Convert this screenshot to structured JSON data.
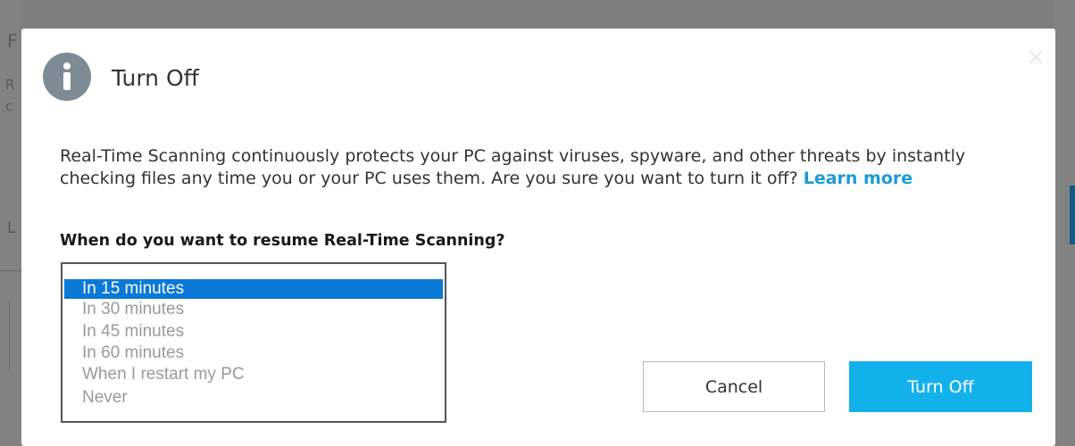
{
  "dialog": {
    "title": "Turn Off",
    "description": "Real-Time Scanning continuously protects your PC against viruses, spyware, and other threats by instantly checking files any time you or your PC uses them. Are you sure you want to turn it off?",
    "learn_more_label": "Learn more",
    "question": "When do you want to resume Real-Time Scanning?",
    "resume_options": [
      "In 15 minutes",
      "In 30 minutes",
      "In 45 minutes",
      "In 60 minutes",
      "When I restart my PC",
      "Never"
    ],
    "selected_option": "In 15 minutes",
    "cancel_label": "Cancel",
    "confirm_label": "Turn Off"
  },
  "background": {
    "glyphs": [
      "F",
      "R",
      "c",
      "L"
    ]
  },
  "icons": {
    "header": "info-icon",
    "close": "close-icon"
  },
  "colors": {
    "accent": "#12b1ec",
    "link": "#1b9ad6",
    "selection": "#0a78d7",
    "info_icon": "#7c8b94"
  }
}
